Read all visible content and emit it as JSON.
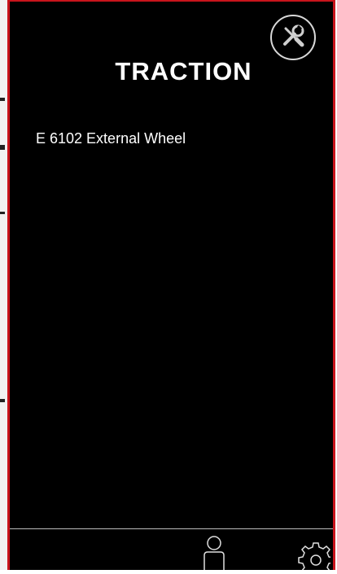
{
  "header": {
    "title": "TRACTION",
    "tools_icon": "tools-icon"
  },
  "content": {
    "item_label": "E 6102 External Wheel"
  },
  "bottom_bar": {
    "profile_icon": "profile-icon",
    "settings_icon": "settings-icon"
  },
  "colors": {
    "background": "#000000",
    "frame_border": "#c8141c",
    "text": "#ffffff"
  }
}
